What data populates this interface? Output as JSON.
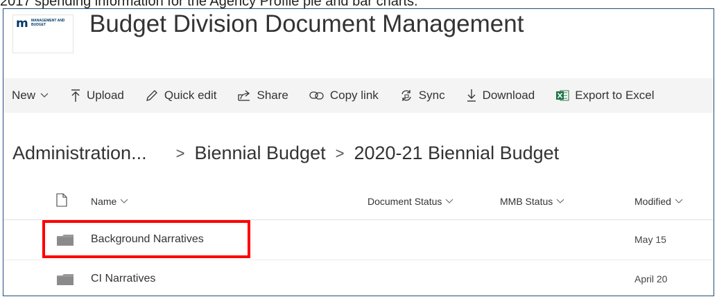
{
  "caption": "2017 spending information for the Agency Profile pie and bar charts.",
  "logo": {
    "letter": "m",
    "text": "MANAGEMENT AND BUDGET"
  },
  "site": {
    "title": "Budget Division Document Management"
  },
  "commands": {
    "new": "New",
    "upload": "Upload",
    "quick_edit": "Quick edit",
    "share": "Share",
    "copy_link": "Copy link",
    "sync": "Sync",
    "download": "Download",
    "export": "Export to Excel"
  },
  "breadcrumb": {
    "items": [
      "Administration...",
      "Biennial Budget",
      "2020-21 Biennial Budget"
    ]
  },
  "columns": {
    "name": "Name",
    "document_status": "Document Status",
    "mmb_status": "MMB Status",
    "modified": "Modified"
  },
  "rows": [
    {
      "name": "Background Narratives",
      "modified": "May 15"
    },
    {
      "name": "CI Narratives",
      "modified": "April 20"
    }
  ],
  "colors": {
    "highlight": "#ff0000",
    "frame": "#1f4e79",
    "command_bar": "#f4f4f4",
    "excel_icon": "#217346"
  }
}
